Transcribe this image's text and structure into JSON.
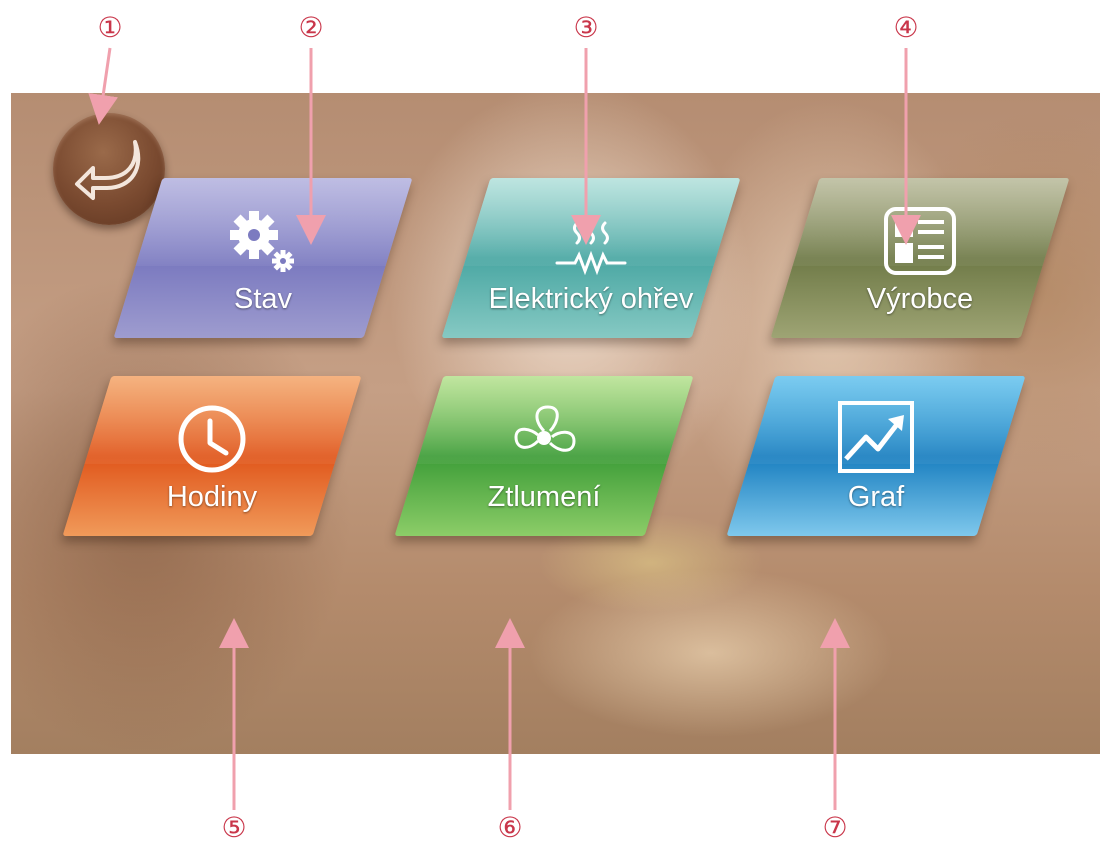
{
  "back_button": {
    "icon": "return-arrow-icon"
  },
  "tiles": [
    {
      "id": "stav",
      "label": "Stav",
      "icon": "gears-icon",
      "color": "#7c7bc0"
    },
    {
      "id": "ohrev",
      "label": "Elektrický ohřev",
      "icon": "heating-element-icon",
      "color": "#4aa7a3"
    },
    {
      "id": "vyrobce",
      "label": "Výrobce",
      "icon": "info-card-icon",
      "color": "#6f7a47"
    },
    {
      "id": "hodiny",
      "label": "Hodiny",
      "icon": "clock-icon",
      "color": "#e0561b"
    },
    {
      "id": "ztlumeni",
      "label": "Ztlumení",
      "icon": "fan-icon",
      "color": "#3e9d38"
    },
    {
      "id": "graf",
      "label": "Graf",
      "icon": "chart-icon",
      "color": "#1a7fc0"
    }
  ],
  "callouts": [
    "①",
    "②",
    "③",
    "④",
    "⑤",
    "⑥",
    "⑦"
  ],
  "colors": {
    "callout": "#c9364a",
    "arrow": "#f0a0ad"
  }
}
